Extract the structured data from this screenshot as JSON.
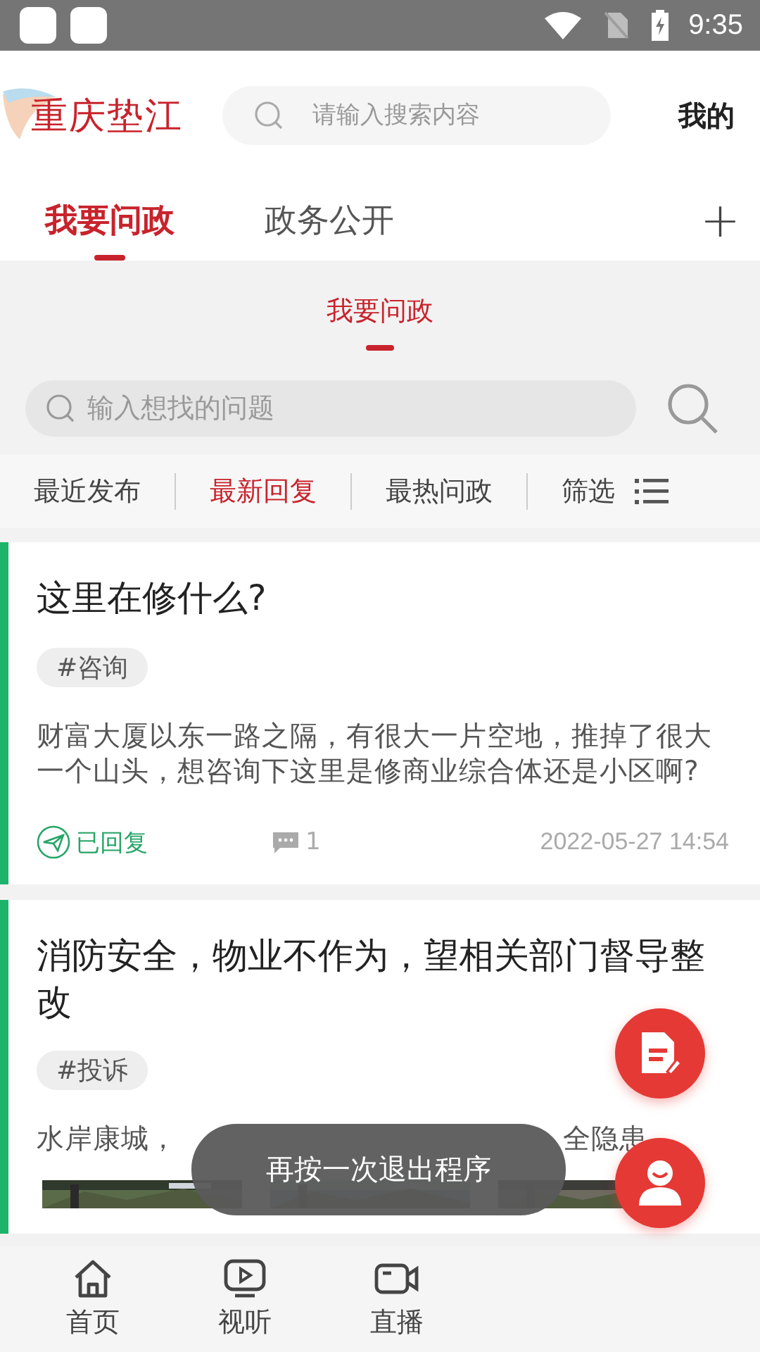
{
  "status_bar": {
    "time": "9:35"
  },
  "header": {
    "logo": "重庆垫江",
    "search": {
      "placeholder": "请输入搜索内容"
    },
    "profile_link": "我的"
  },
  "tabs": [
    {
      "label": "我要问政",
      "selected": true
    },
    {
      "label": "政务公开",
      "selected": false
    }
  ],
  "add_tab_button": "+",
  "sub_tabs": [
    {
      "label": "我要问政",
      "selected": true
    }
  ],
  "question_search": {
    "placeholder": "输入想找的问题"
  },
  "filters": [
    {
      "label": "最近发布",
      "selected": false
    },
    {
      "label": "最新回复",
      "selected": true
    },
    {
      "label": "最热问政",
      "selected": false
    },
    {
      "label": "筛选",
      "selected": false
    }
  ],
  "posts": [
    {
      "title": "这里在修什么?",
      "tag": "#咨询",
      "description": "财富大厦以东一路之隔，有很大一片空地，推掉了很大一个山头，想咨询下这里是修商业综合体还是小区啊?",
      "status": "已回复",
      "replied": true,
      "comments": "1",
      "date": "2022-05-27 14:54"
    },
    {
      "title": "消防安全，物业不作为，望相关部门督导整改",
      "tag": "#投诉",
      "description_parts": [
        "水岸康城，",
        "全隐患"
      ],
      "pictures": [
        {
          "kind": "picture"
        },
        {
          "kind": "picture"
        },
        {
          "kind": "picture"
        }
      ]
    }
  ],
  "toast": "再按一次退出程序",
  "bottom_nav": [
    {
      "label": "首页",
      "kind": "home"
    },
    {
      "label": "视听",
      "kind": "video"
    },
    {
      "label": "直播",
      "kind": "camera"
    }
  ]
}
